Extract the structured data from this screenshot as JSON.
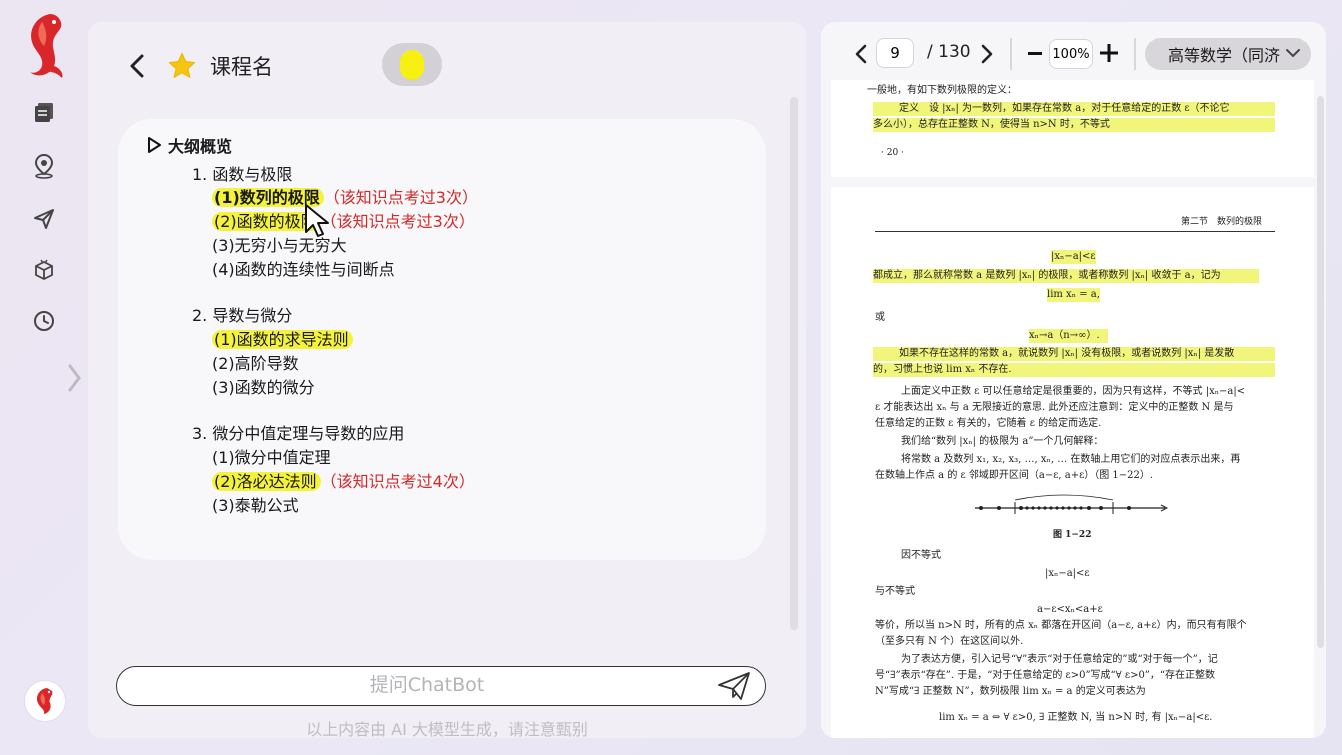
{
  "sidebar": {
    "nav": [
      {
        "icon": "book-list-icon"
      },
      {
        "icon": "map-pin-icon"
      },
      {
        "icon": "send-icon"
      },
      {
        "icon": "cube-box-icon"
      },
      {
        "icon": "clock-icon"
      }
    ]
  },
  "header": {
    "course_name": "课程名"
  },
  "outline": {
    "heading": "大纲概览",
    "chapters": [
      {
        "title": "1. 函数与极限",
        "items": [
          {
            "label": "(1)数列的极限",
            "highlighted": true,
            "bold": true,
            "note": "（该知识点考过3次）"
          },
          {
            "label": "(2)函数的极限",
            "highlighted": true,
            "bold": true,
            "note": "（该知识点考过3次）"
          },
          {
            "label": "(3)无穷小与无穷大",
            "highlighted": false,
            "note": ""
          },
          {
            "label": "(4)函数的连续性与间断点",
            "highlighted": false,
            "note": ""
          }
        ]
      },
      {
        "title": "2. 导数与微分",
        "items": [
          {
            "label": "(1)函数的求导法则",
            "highlighted": true,
            "note": ""
          },
          {
            "label": "(2)高阶导数",
            "highlighted": false,
            "note": ""
          },
          {
            "label": "(3)函数的微分",
            "highlighted": false,
            "note": ""
          }
        ]
      },
      {
        "title": "3. 微分中值定理与导数的应用",
        "items": [
          {
            "label": "(1)微分中值定理",
            "highlighted": false,
            "note": ""
          },
          {
            "label": "(2)洛必达法则",
            "highlighted": true,
            "note": "（该知识点考过4次）"
          },
          {
            "label": "(3)泰勒公式",
            "highlighted": false,
            "note": ""
          }
        ]
      }
    ]
  },
  "chat": {
    "placeholder": "提问ChatBot",
    "disclaimer": "以上内容由 AI 大模型生成，请注意甄别"
  },
  "pdf_viewer": {
    "current_page": "9",
    "total_pages": "/ 130",
    "zoom": "100%",
    "book": "高等数学（同济",
    "page1": {
      "lines": [
        {
          "text": "一般地，有如下数列极限的定义：",
          "hl": false
        },
        {
          "text": "定义　设 |xₙ| 为一数列，如果存在常数 a，对于任意给定的正数 ε（不论它",
          "hl": true
        },
        {
          "text": "多么小），总存在正整数 N，使得当 n>N 时，不等式",
          "hl": true
        },
        {
          "text": "· 20 ·",
          "hl": false
        }
      ]
    },
    "page2": {
      "running_head": "第二节　数列的极限",
      "lines": [
        {
          "text": "|xₙ−a|<ε",
          "hl": true
        },
        {
          "text": "都成立，那么就称常数 a 是数列 |xₙ| 的极限，或者称数列 |xₙ| 收敛于 a，记为",
          "hl": true
        },
        {
          "text": "lim xₙ = a,",
          "hl": true
        },
        {
          "text": "或",
          "hl": false
        },
        {
          "text": "xₙ→a（n→∞）.",
          "hl": true
        },
        {
          "text": "如果不存在这样的常数 a，就说数列 |xₙ| 没有极限，或者说数列 |xₙ| 是发散",
          "hl": true
        },
        {
          "text": "的，习惯上也说 lim xₙ 不存在.",
          "hl": true
        },
        {
          "text": "上面定义中正数 ε 可以任意给定是很重要的，因为只有这样，不等式 |xₙ−a|<",
          "hl": false
        },
        {
          "text": "ε 才能表达出 xₙ 与 a 无限接近的意思. 此外还应注意到：定义中的正整数 N 是与",
          "hl": false
        },
        {
          "text": "任意给定的正数 ε 有关的，它随着 ε 的给定而选定.",
          "hl": false
        },
        {
          "text": "我们给“数列 |xₙ| 的极限为 a”一个几何解释：",
          "hl": false
        },
        {
          "text": "将常数 a 及数列 x₁, x₂, x₃, …, xₙ, … 在数轴上用它们的对应点表示出来，再",
          "hl": false
        },
        {
          "text": "在数轴上作点 a 的 ε 邻域即开区间（a−ε, a+ε）（图 1−22）.",
          "hl": false
        },
        {
          "text": "图 1−22",
          "hl": false
        },
        {
          "text": "因不等式",
          "hl": false
        },
        {
          "text": "|xₙ−a|<ε",
          "hl": false
        },
        {
          "text": "与不等式",
          "hl": false
        },
        {
          "text": "a−ε<xₙ<a+ε",
          "hl": false
        },
        {
          "text": "等价，所以当 n>N 时，所有的点 xₙ 都落在开区间（a−ε, a+ε）内，而只有有限个",
          "hl": false
        },
        {
          "text": "（至多只有 N 个）在这区间以外.",
          "hl": false
        },
        {
          "text": "为了表达方便，引入记号“∀”表示“对于任意给定的”或“对于每一个”，记",
          "hl": false
        },
        {
          "text": "号“∃”表示“存在”. 于是，“对于任意给定的 ε>0”写成“∀ ε>0”，“存在正整数",
          "hl": false
        },
        {
          "text": "N”写成“∃ 正整数 N”，数列极限 lim xₙ = a 的定义可表达为",
          "hl": false
        },
        {
          "text": "lim xₙ = a ⇔ ∀ ε>0, ∃ 正整数 N, 当 n>N 时, 有 |xₙ−a|<ε.",
          "hl": false
        }
      ]
    }
  },
  "colors": {
    "highlight": "#f4f23a",
    "note_red": "#d42a2a",
    "star": "#f6c514",
    "logo_red": "#d8262b"
  }
}
